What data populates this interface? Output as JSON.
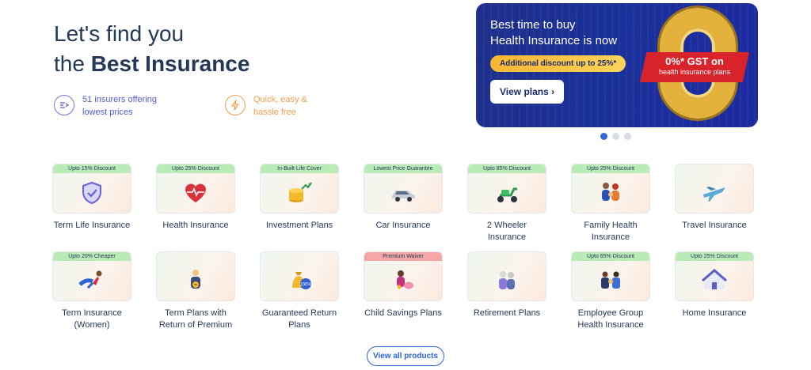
{
  "hero": {
    "line1": "Let's find you",
    "line2_prefix": "the ",
    "line2_bold": "Best Insurance"
  },
  "features": [
    {
      "icon": "insurers-icon",
      "line1": "51 insurers offering",
      "line2": "lowest prices"
    },
    {
      "icon": "lightning-icon",
      "line1": "Quick, easy &",
      "line2": "hassle free"
    }
  ],
  "banner": {
    "title1": "Best time to buy",
    "title2": "Health Insurance is now",
    "discount": "Additional discount up to 25%*",
    "cta": "View plans ›",
    "gst_big": "0%* GST on",
    "gst_small": "health insurance plans"
  },
  "carousel": {
    "slides": 3,
    "active": 1
  },
  "products": [
    {
      "tag": "Upto 15% Discount",
      "tag_color": "#b9ebb7",
      "icon": "shield-icon",
      "label": "Term Life Insurance"
    },
    {
      "tag": "Upto 25% Discount",
      "tag_color": "#b9ebb7",
      "icon": "heart-icon",
      "label": "Health Insurance"
    },
    {
      "tag": "In-Built Life Cover",
      "tag_color": "#b9ebb7",
      "icon": "coins-growth-icon",
      "label": "Investment Plans"
    },
    {
      "tag": "Lowest Price Guarantee",
      "tag_color": "#b9ebb7",
      "icon": "car-icon",
      "label": "Car Insurance"
    },
    {
      "tag": "Upto 85% Discount",
      "tag_color": "#b9ebb7",
      "icon": "scooter-icon",
      "label": "2 Wheeler Insurance"
    },
    {
      "tag": "Upto 25% Discount",
      "tag_color": "#b9ebb7",
      "icon": "family-icon",
      "label": "Family Health Insurance"
    },
    {
      "tag": "",
      "tag_color": "",
      "icon": "airplane-icon",
      "label": "Travel Insurance"
    },
    {
      "tag": "Upto 20% Cheaper",
      "tag_color": "#b9ebb7",
      "icon": "superwoman-icon",
      "label": "Term Insurance (Women)"
    },
    {
      "tag": "",
      "tag_color": "",
      "icon": "return-premium-icon",
      "label": "Term Plans with Return of Premium"
    },
    {
      "tag": "",
      "tag_color": "",
      "icon": "money-bag-icon",
      "label": "Guaranteed Return Plans"
    },
    {
      "tag": "Premium Waiver",
      "tag_color": "#f5a6a6",
      "icon": "child-savings-icon",
      "label": "Child Savings Plans"
    },
    {
      "tag": "",
      "tag_color": "",
      "icon": "elderly-couple-icon",
      "label": "Retirement Plans"
    },
    {
      "tag": "Upto 65% Discount",
      "tag_color": "#b9ebb7",
      "icon": "employees-icon",
      "label": "Employee Group Health Insurance"
    },
    {
      "tag": "Upto 25% Discount",
      "tag_color": "#b9ebb7",
      "icon": "house-icon",
      "label": "Home Insurance"
    }
  ],
  "view_all": "View all products"
}
